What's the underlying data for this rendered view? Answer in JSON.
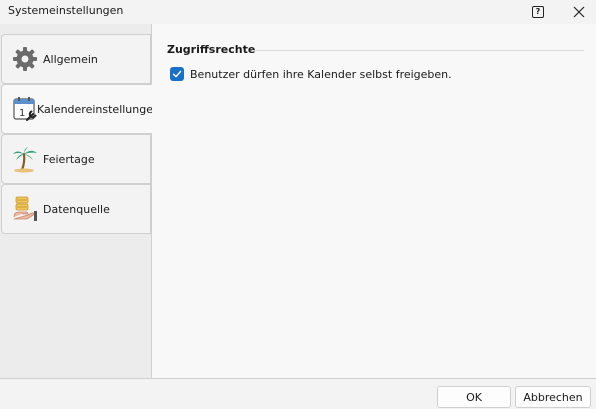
{
  "window": {
    "title": "Systemeinstellungen",
    "help_glyph": "?"
  },
  "sidebar": {
    "items": [
      {
        "label": "Allgemein",
        "icon": "gear-icon"
      },
      {
        "label": "Kalendereinstellungen",
        "icon": "calendar-wrench-icon"
      },
      {
        "label": "Feiertage",
        "icon": "palm-tree-icon"
      },
      {
        "label": "Datenquelle",
        "icon": "database-hand-icon"
      }
    ],
    "active_index": 1
  },
  "content": {
    "section_title": "Zugriffsrechte",
    "checkbox_label": "Benutzer dürfen ihre Kalender selbst freigeben.",
    "checkbox_checked": true
  },
  "footer": {
    "ok_label": "OK",
    "cancel_label": "Abbrechen"
  },
  "colors": {
    "accent": "#1a6fc7",
    "background": "#f3f3f3",
    "border": "#cfcfcf"
  }
}
